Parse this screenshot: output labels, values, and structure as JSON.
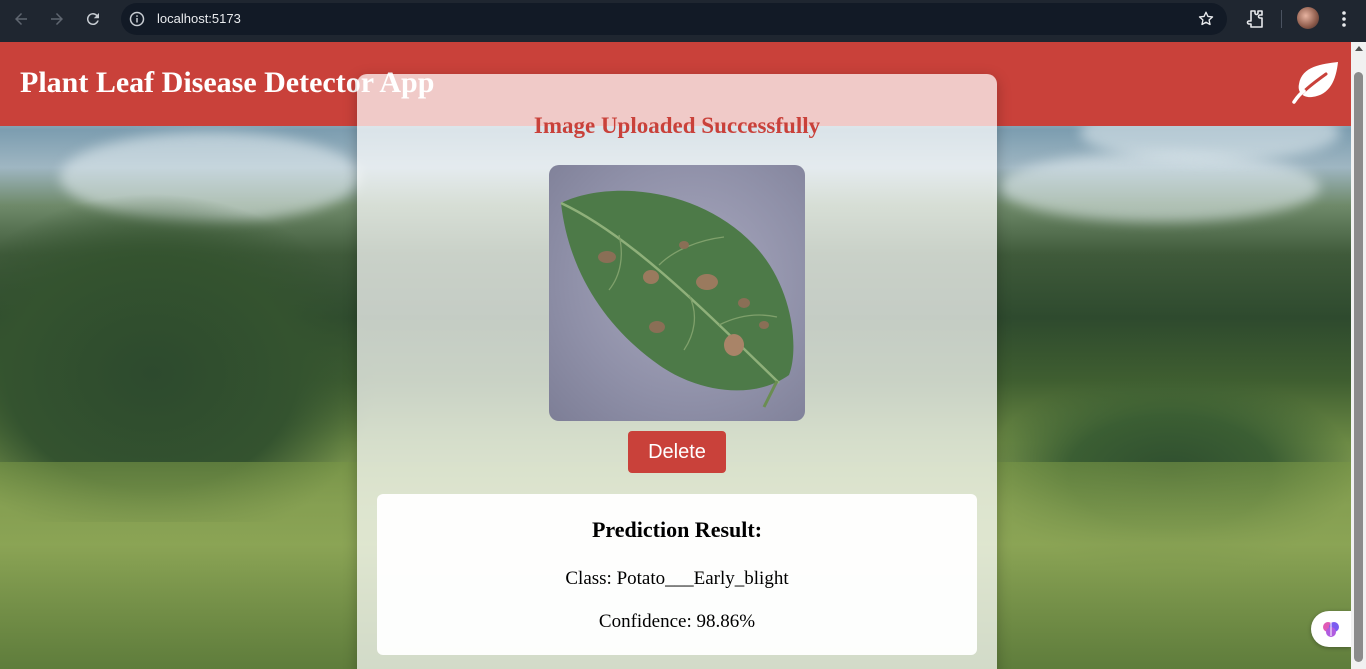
{
  "browser": {
    "url": "localhost:5173",
    "icons": {
      "back": "arrow-left-icon",
      "forward": "arrow-right-icon",
      "reload": "reload-icon",
      "info": "info-icon",
      "bookmark": "star-icon",
      "extensions": "puzzle-icon",
      "profile": "avatar",
      "menu": "kebab-menu-icon"
    }
  },
  "header": {
    "title": "Plant Leaf Disease Detector App",
    "logo_icon": "leaf-icon",
    "background_color": "#c9413a"
  },
  "upload_card": {
    "status": "Image Uploaded Successfully",
    "image_alt": "leaf-image",
    "delete_label": "Delete"
  },
  "prediction": {
    "heading": "Prediction Result:",
    "class_line": "Class: Potato___Early_blight",
    "confidence_line": "Confidence: 98.86%"
  },
  "colors": {
    "accent": "#c9413a",
    "chrome_bg": "#1f2630"
  },
  "widget": {
    "icon": "brain-icon"
  }
}
